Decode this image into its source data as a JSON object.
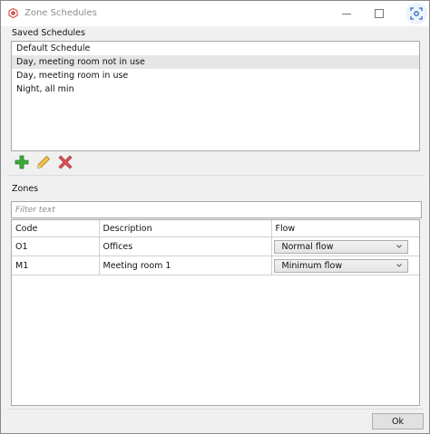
{
  "window": {
    "title": "Zone Schedules",
    "controls": [
      "minimize",
      "maximize",
      "close"
    ]
  },
  "saved_schedules": {
    "label": "Saved Schedules",
    "items": [
      {
        "label": "Default Schedule",
        "selected": false
      },
      {
        "label": "Day, meeting room not in use",
        "selected": true
      },
      {
        "label": "Day, meeting room in use",
        "selected": false
      },
      {
        "label": "Night, all min",
        "selected": false
      }
    ],
    "toolbar": {
      "add_icon": "plus-icon",
      "edit_icon": "pencil-icon",
      "delete_icon": "x-icon",
      "add_color": "#3cab3c",
      "delete_color": "#d9534f"
    }
  },
  "zones": {
    "label": "Zones",
    "filter_placeholder": "Filter text",
    "columns": [
      "Code",
      "Description",
      "Flow"
    ],
    "rows": [
      {
        "code": "O1",
        "description": "Offices",
        "flow": "Normal flow"
      },
      {
        "code": "M1",
        "description": "Meeting room 1",
        "flow": "Minimum flow"
      }
    ]
  },
  "footer": {
    "ok_label": "Ok"
  }
}
